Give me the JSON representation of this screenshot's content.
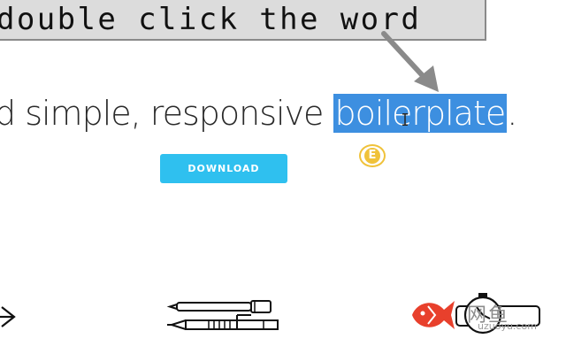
{
  "banner": {
    "text": "double click the word"
  },
  "hero": {
    "before_text": "d simple, responsive ",
    "selected_text": "boilerplate",
    "after_text": "."
  },
  "badge": {
    "letter": "E"
  },
  "download_button": {
    "label": "DOWNLOAD"
  },
  "icons": [
    "arrow-right-icon",
    "pen-and-pencil-icon",
    "stopwatch-icon"
  ],
  "watermark": {
    "text": "uzuoyu.com",
    "cjk_text": "网鱼"
  },
  "colors": {
    "selection": "#3d8fe0",
    "button": "#2fc0ef",
    "badge": "#f0c23a",
    "banner_bg": "#dcdcdc",
    "fish_red": "#e8402c"
  }
}
